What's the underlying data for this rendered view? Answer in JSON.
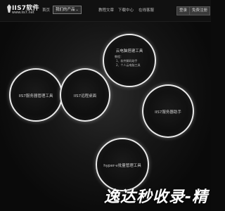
{
  "header": {
    "logo": {
      "title": "IIS7软件",
      "url_text": "www.iis7.net"
    },
    "nav": [
      {
        "label": "首页",
        "active": false
      },
      {
        "label": "我们的产品",
        "active": true,
        "has_caret": true
      },
      {
        "label": "教程文章",
        "active": false
      },
      {
        "label": "下载中心",
        "active": false
      },
      {
        "label": "在线客服",
        "active": false
      }
    ],
    "buttons": {
      "login": "登录",
      "register": "免费注册"
    }
  },
  "bubbles": {
    "cloud_build": {
      "title": "云电脑搭建工具",
      "lines": [
        "教程：",
        "1、软件解码助手",
        "2、个人云电脑工具"
      ]
    },
    "server_manager": {
      "title": "IIS7服务器管理工具"
    },
    "remote_desktop": {
      "title": "IIS7远程桌面"
    },
    "server_helper": {
      "title": "IIS7服务器助手"
    },
    "hyperv_manager": {
      "title": "hyper-v批量管理工具"
    }
  },
  "watermark": "逸达秒收录-精"
}
